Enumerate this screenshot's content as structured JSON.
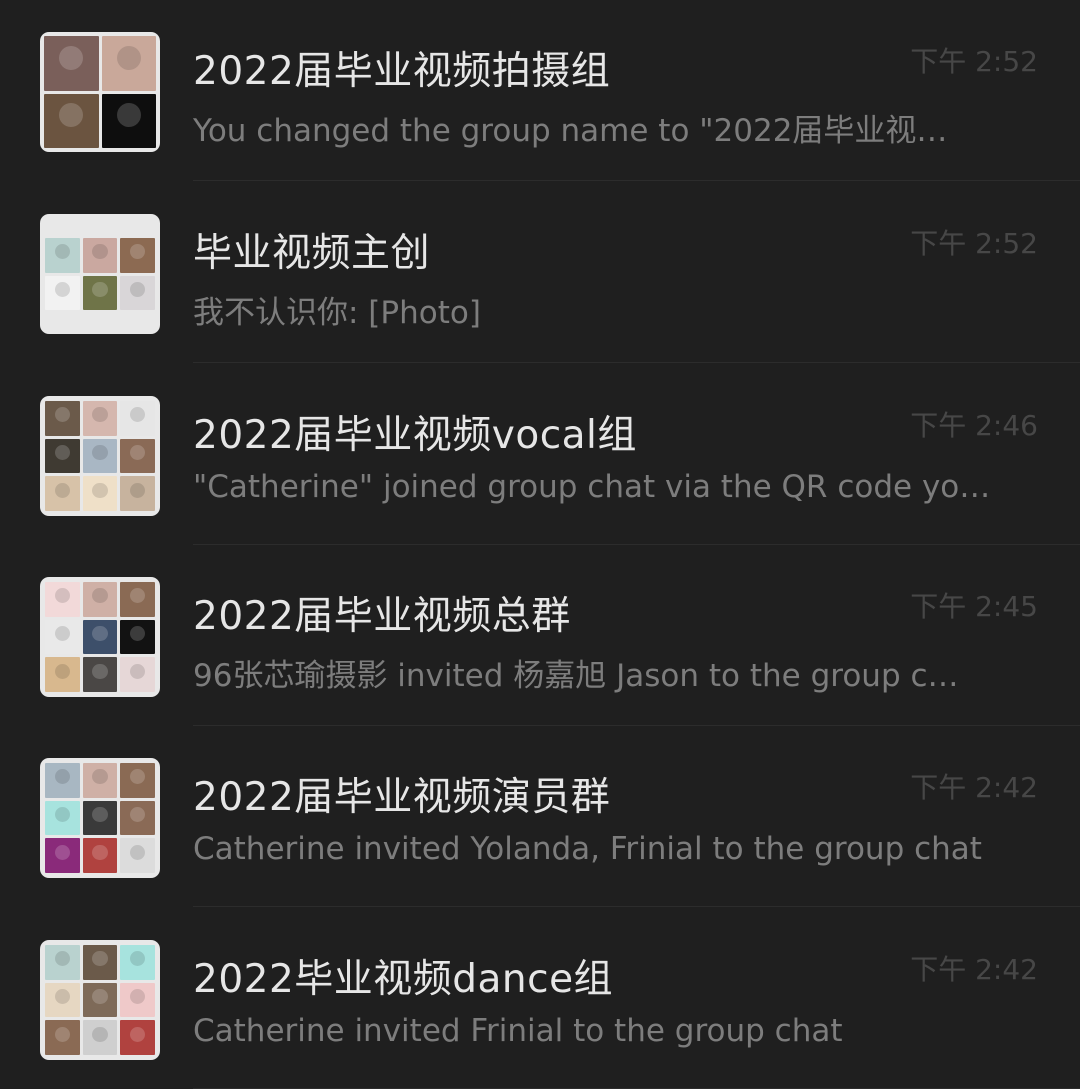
{
  "chats": [
    {
      "title": "2022届毕业视频拍摄组",
      "preview": "You changed the group name to \"2022届毕业视…",
      "time": "下午 2:52",
      "avatar": {
        "grid": 2,
        "colors": [
          "#7a5f5a",
          "#c9a89a",
          "#6b5440",
          "#0e0e0e"
        ]
      }
    },
    {
      "title": "毕业视频主创",
      "preview": "我不认识你: [Photo]",
      "time": "下午 2:52",
      "avatar": {
        "grid": 3,
        "colors": [
          "#b9d2cf",
          "#caa8a0",
          "#8c6a52",
          "#f2f2f2",
          "#6f7448",
          "#d9d6d8"
        ]
      }
    },
    {
      "title": "2022届毕业视频vocal组",
      "preview": "\"Catherine\" joined group chat via the QR code yo…",
      "time": "下午 2:46",
      "avatar": {
        "grid": 3,
        "colors": [
          "#6b5a4a",
          "#d5b7ae",
          "#e6e6e6",
          "#3f3a32",
          "#a9b7c4",
          "#8a6a56",
          "#d7c2a8",
          "#efe0c8",
          "#c7b39e"
        ]
      }
    },
    {
      "title": "2022届毕业视频总群",
      "preview": "96张芯瑜摄影 invited 杨嘉旭 Jason to the group c…",
      "time": "下午 2:45",
      "avatar": {
        "grid": 3,
        "colors": [
          "#f2d9d9",
          "#cfb0a6",
          "#8a6a54",
          "#e9e9e9",
          "#3d4f6a",
          "#121212",
          "#d8b88e",
          "#4a4745",
          "#e6d7d7"
        ]
      }
    },
    {
      "title": "2022届毕业视频演员群",
      "preview": "Catherine invited Yolanda, Frinial to the group chat",
      "time": "下午 2:42",
      "avatar": {
        "grid": 3,
        "colors": [
          "#a8b7c2",
          "#cfb0a6",
          "#8a6a54",
          "#a7e3de",
          "#3a3a3a",
          "#8a6a56",
          "#8a2a7a",
          "#b0423f",
          "#dcdcdc"
        ]
      }
    },
    {
      "title": "2022毕业视频dance组",
      "preview": "Catherine invited Frinial to the group chat",
      "time": "下午 2:42",
      "avatar": {
        "grid": 3,
        "colors": [
          "#b9d2cf",
          "#6b5a4a",
          "#a7e3de",
          "#e6d7c2",
          "#7e6a58",
          "#efc9c9",
          "#8a6a54",
          "#cfcfcf",
          "#b0423f"
        ]
      }
    }
  ]
}
